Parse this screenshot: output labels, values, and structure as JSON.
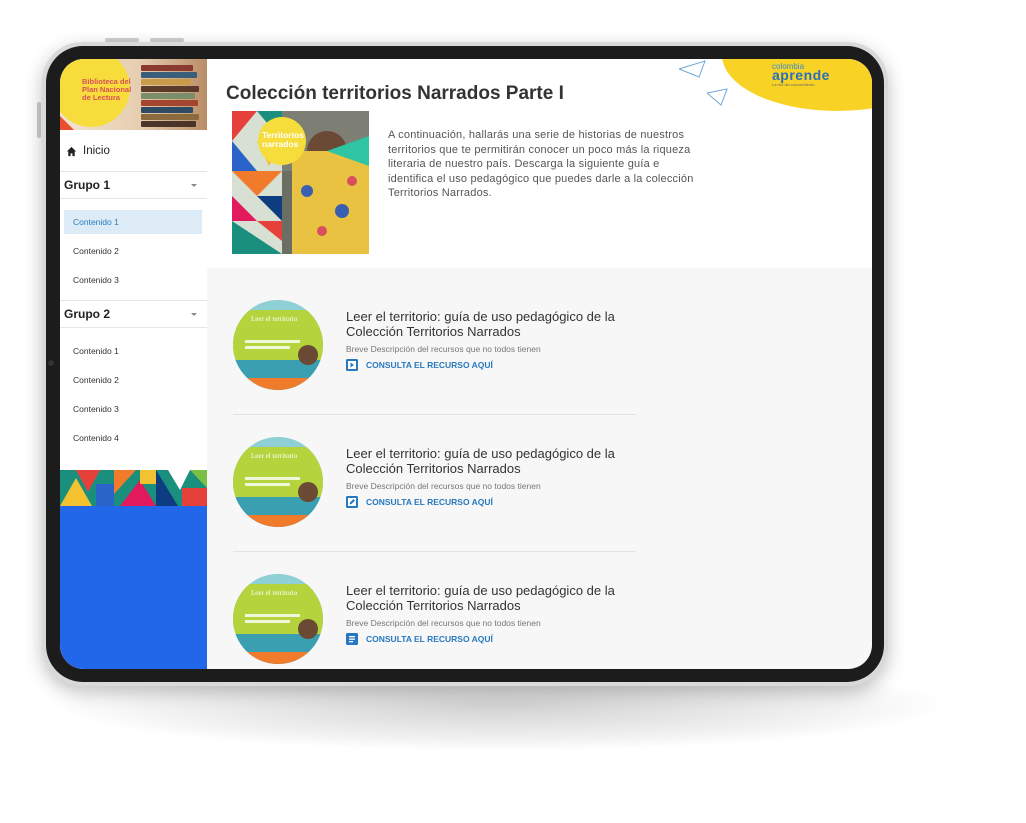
{
  "sidebar": {
    "hero_title": "Biblioteca del Plan Nacional de Lectura",
    "home_label": "Inicio",
    "groups": [
      {
        "label": "Grupo 1",
        "items": [
          {
            "label": "Contenido 1",
            "active": true
          },
          {
            "label": "Contenido 2"
          },
          {
            "label": "Contenido 3"
          }
        ]
      },
      {
        "label": "Grupo 2",
        "items": [
          {
            "label": "Contenido 1"
          },
          {
            "label": "Contenido 2"
          },
          {
            "label": "Contenido 3"
          },
          {
            "label": "Contenido 4"
          }
        ]
      }
    ]
  },
  "header": {
    "title": "Colección territorios Narrados Parte I",
    "intro": "A continuación, hallarás una serie de historias de nuestros territorios que te permitirán conocer un poco más la riqueza literaria de nuestro país. Descarga la siguiente guía e identifica el uso pedagógico que puedes darle a la colección Territorios Narrados.",
    "cover_label": "Territorios narrados",
    "logo": {
      "top": "colombia",
      "main": "aprende",
      "sub": "La red del conocimiento"
    }
  },
  "resources": [
    {
      "title": "Leer el territorio: guía de uso pedagógico de la Colección Territorios Narrados",
      "description": "Breve Descripción del recursos que no todos tienen",
      "link_label": "CONSULTA EL RECURSO AQUÍ",
      "icon": "video-icon",
      "thumb_label": "Leer el territorio"
    },
    {
      "title": "Leer el territorio: guía de uso pedagógico de la Colección Territorios Narrados",
      "description": "Breve Descripción del recursos que no todos tienen",
      "link_label": "CONSULTA EL RECURSO AQUÍ",
      "icon": "edit-icon",
      "thumb_label": "Leer el territorio"
    },
    {
      "title": "Leer el territorio: guía de uso pedagógico de la Colección Territorios Narrados",
      "description": "Breve Descripción del recursos que no todos tienen",
      "link_label": "CONSULTA EL RECURSO AQUÍ",
      "icon": "document-icon",
      "thumb_label": "Leer el territorio"
    }
  ],
  "colors": {
    "accent_blue": "#2779bf",
    "sidebar_blue": "#2266ea",
    "logo_yellow": "#f8d326",
    "active_bg": "#dcebf5"
  }
}
